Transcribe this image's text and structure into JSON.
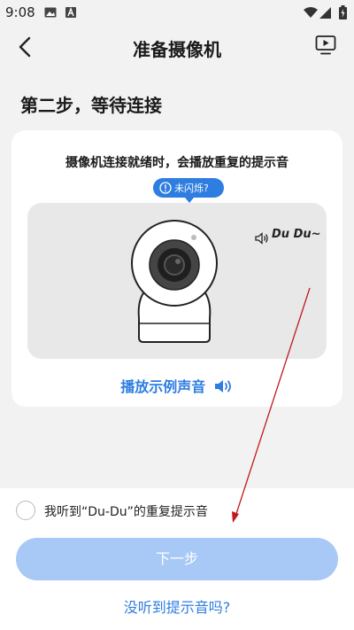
{
  "status_bar": {
    "time": "9:08"
  },
  "nav": {
    "title": "准备摄像机"
  },
  "step_title": "第二步，等待连接",
  "card": {
    "hint": "摄像机连接就绪时，会播放重复的提示音",
    "tooltip_label": "未闪烁?",
    "sound_text": "Du Du~",
    "play_sample_label": "播放示例声音"
  },
  "bottom": {
    "checkbox_label": "我听到“Du-Du”的重复提示音",
    "checkbox_checked": false,
    "next_label": "下一步",
    "not_heard_label": "没听到提示音吗?"
  },
  "colors": {
    "accent": "#2e7de0",
    "next_button_disabled": "#a8c8f6",
    "annotation_arrow": "#c0191f"
  },
  "icons": [
    "gallery-icon",
    "a-icon",
    "wifi-icon",
    "signal-icon",
    "battery-icon",
    "back-arrow-icon",
    "video-tutorial-icon",
    "info-icon",
    "speaker-icon",
    "speaker-wave-icon"
  ]
}
